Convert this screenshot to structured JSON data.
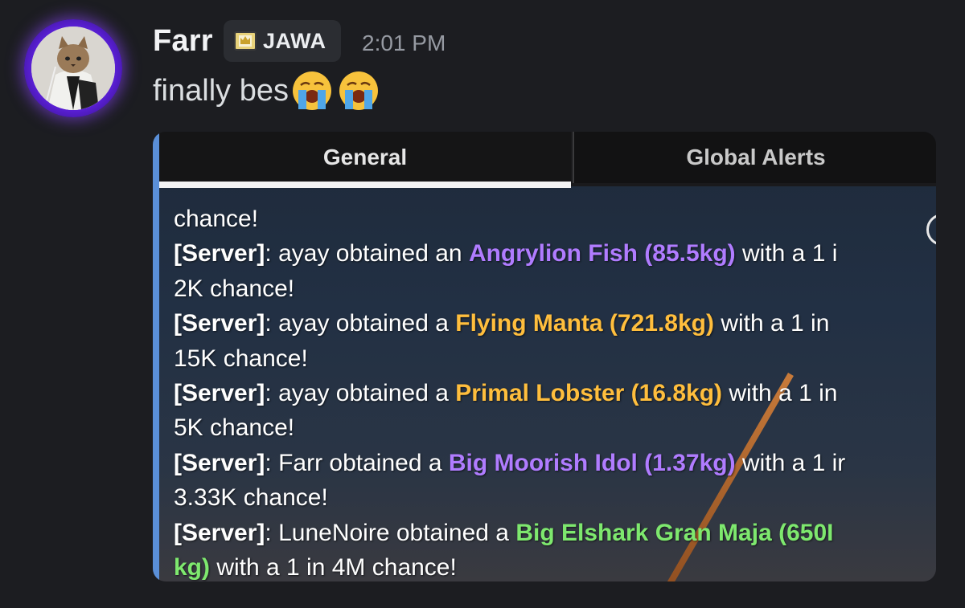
{
  "message": {
    "username": "Farr",
    "tag": {
      "label": "JAWA",
      "icon": "guild-badge-icon"
    },
    "timestamp": "2:01 PM",
    "text": "finally bes",
    "emojis": [
      "loudly-crying-face-icon",
      "loudly-crying-face-icon"
    ],
    "colors": {
      "background": "#1c1d21",
      "avatar_ring": "#7a3cff",
      "username": "#f2f3f5",
      "timestamp": "#969aa2"
    }
  },
  "attachment": {
    "tabs": [
      {
        "label": "General",
        "active": true
      },
      {
        "label": "Global Alerts",
        "active": false
      }
    ],
    "chat_lines": [
      {
        "prefix": "",
        "player": "",
        "item": "",
        "rest": "chance!"
      },
      {
        "prefix": "[Server]",
        "rest_a": ": ayay obtained an ",
        "item": "Angrylion Fish (85.5kg)",
        "item_color": "purple",
        "rest_b": " with a 1 i"
      },
      {
        "prefix": "",
        "rest": "2K chance!"
      },
      {
        "prefix": "[Server]",
        "rest_a": ": ayay obtained a ",
        "item": "Flying Manta (721.8kg)",
        "item_color": "orange",
        "rest_b": " with a 1 in"
      },
      {
        "prefix": "",
        "rest": "15K chance!"
      },
      {
        "prefix": "[Server]",
        "rest_a": ": ayay obtained a ",
        "item": "Primal Lobster (16.8kg)",
        "item_color": "orange",
        "rest_b": " with a 1 in"
      },
      {
        "prefix": "",
        "rest": "5K chance!"
      },
      {
        "prefix": "[Server]",
        "rest_a": ": Farr obtained a ",
        "item": "Big Moorish Idol (1.37kg)",
        "item_color": "purple",
        "rest_b": " with a 1 ir"
      },
      {
        "prefix": "",
        "rest": "3.33K chance!"
      },
      {
        "prefix": "[Server]",
        "rest_a": ": LuneNoire obtained a ",
        "item": "Big Elshark Gran Maja (650I",
        "item_color": "green",
        "rest_b": ""
      },
      {
        "prefix": "",
        "item_cont": "kg)",
        "item_color": "green",
        "rest": " with a 1 in 4M chance!"
      }
    ],
    "colors": {
      "purple": "#b07cff",
      "orange": "#ffbe3d",
      "green": "#7ee86e",
      "accent": "#5a8fd8"
    }
  }
}
